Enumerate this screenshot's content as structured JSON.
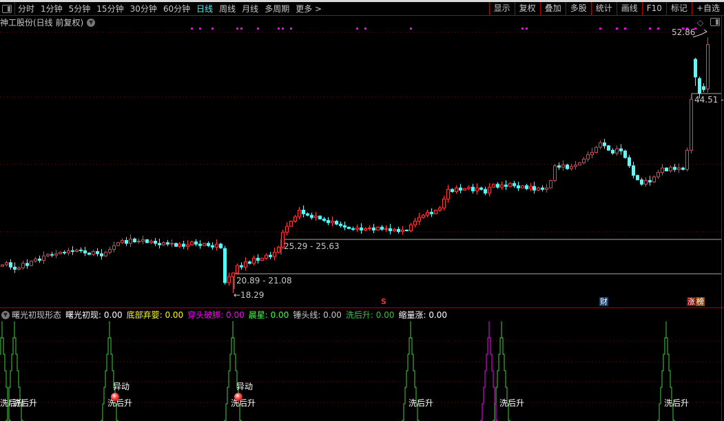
{
  "toolbar": {
    "periods": [
      "分时",
      "1分钟",
      "5分钟",
      "15分钟",
      "30分钟",
      "60分钟",
      "日线",
      "周线",
      "月线",
      "多周期",
      "更多 >"
    ],
    "active_period": "日线",
    "right_buttons": [
      "显示",
      "复权",
      "叠加",
      "多股",
      "统计",
      "画线",
      "F10",
      "标记",
      "+自选"
    ]
  },
  "chart_title": "神工股份(日线 前复权)",
  "colors": {
    "up": "#ff3c3c",
    "down": "#54ffff",
    "grid": "#8b0000",
    "accent": "#4ff0f0",
    "magenta": "#ff00ff",
    "green": "#40d040",
    "separator": "#b00000"
  },
  "annotations": {
    "high_label": "52.86",
    "gap_top_label": "44.51 -",
    "gap_mid_label": "25.29 - 25.63",
    "gap_low_label": "20.89 - 21.08",
    "low_label": "←18.29"
  },
  "event_markers": {
    "s": "S",
    "cai": "财",
    "zhang": "涨",
    "bang": "榜"
  },
  "indicator": {
    "name": "曙光初现形态",
    "items": [
      {
        "label": "曙光初现: 0.00",
        "color": "#ffffff"
      },
      {
        "label": "底部弃婴: 0.00",
        "color": "#ffff00"
      },
      {
        "label": "穿头破脚: 0.00",
        "color": "#ff00ff"
      },
      {
        "label": "晨星: 0.00",
        "color": "#40ff40"
      },
      {
        "label": "锤头线: 0.00",
        "color": "#c8c8c8"
      },
      {
        "label": "洗后升: 0.00",
        "color": "#40c040"
      },
      {
        "label": "缩量涨: 0.00",
        "color": "#ffffff"
      }
    ],
    "signal_text_wash": "洗后升",
    "signal_text_move": "异动"
  },
  "chart_data": {
    "type": "candlestick",
    "closes": [
      22.1,
      22.4,
      21.8,
      21.5,
      21.7,
      22.3,
      22.0,
      22.6,
      22.9,
      22.7,
      23.3,
      23.5,
      23.4,
      23.6,
      23.8,
      23.7,
      24.0,
      23.9,
      24.1,
      24.0,
      23.7,
      23.5,
      23.9,
      23.6,
      23.3,
      23.8,
      24.2,
      24.7,
      25.1,
      25.4,
      25.0,
      25.6,
      25.2,
      25.3,
      25.5,
      25.1,
      25.3,
      25.0,
      24.8,
      25.1,
      24.9,
      25.0,
      24.6,
      24.9,
      24.6,
      24.8,
      25.2,
      24.9,
      24.7,
      25.0,
      24.7,
      24.5,
      24.9,
      24.4,
      19.7,
      20.5,
      21.0,
      22.0,
      21.8,
      22.5,
      22.3,
      23.0,
      22.7,
      23.0,
      23.4,
      23.2,
      23.8,
      24.5,
      26.5,
      27.3,
      28.0,
      28.6,
      29.5,
      29.0,
      28.8,
      28.5,
      28.7,
      28.3,
      28.1,
      27.8,
      28.0,
      27.6,
      27.4,
      27.2,
      27.0,
      26.9,
      27.1,
      26.8,
      27.0,
      27.1,
      26.8,
      27.2,
      26.9,
      27.0,
      26.7,
      26.9,
      26.6,
      26.8,
      26.7,
      27.5,
      28.0,
      28.5,
      28.8,
      29.2,
      29.0,
      29.5,
      29.8,
      31.0,
      32.3,
      32.0,
      32.5,
      32.2,
      32.4,
      32.6,
      32.1,
      32.5,
      32.3,
      31.8,
      32.6,
      33.0,
      32.6,
      32.9,
      32.7,
      33.1,
      32.8,
      32.5,
      32.8,
      32.4,
      32.7,
      32.2,
      32.5,
      32.3,
      32.5,
      33.5,
      35.5,
      35.3,
      35.6,
      35.1,
      35.4,
      35.6,
      35.9,
      36.4,
      37.0,
      37.3,
      38.0,
      38.6,
      38.2,
      37.6,
      37.2,
      37.8,
      37.5,
      36.6,
      35.5,
      34.2,
      33.6,
      33.0,
      33.5,
      33.3,
      34.0,
      34.6,
      35.2,
      34.8,
      35.3,
      35.0,
      35.2,
      35.0,
      37.6,
      44.5,
      47.5,
      45.3,
      45.8,
      51.9
    ],
    "open_overrides": {
      "54": 24.3,
      "168": 49.9,
      "169": 47.3,
      "170": 46.2,
      "171": 45.9
    },
    "low_overrides": {
      "56": 18.29,
      "168": 46.3,
      "169": 44.6
    },
    "high_overrides": {
      "171": 52.86,
      "168": 50.1
    },
    "max_price": 52.86,
    "min_price": 18.29,
    "grid": true,
    "top_dot_candles": [
      46,
      48,
      51,
      57,
      58,
      62,
      67,
      68,
      70,
      86,
      88,
      99,
      126,
      127,
      145,
      149,
      151,
      157,
      159,
      165,
      166,
      168
    ],
    "wash_signal_candles": [
      0,
      3,
      26,
      56,
      99,
      121,
      161
    ],
    "pierce_signal_candles": [
      118
    ],
    "move_signal_candles": [
      27,
      57
    ]
  }
}
